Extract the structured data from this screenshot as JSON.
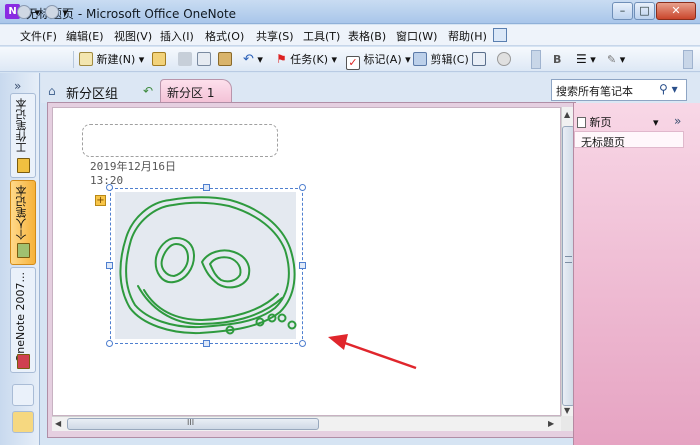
{
  "window": {
    "title": "无标题页 - Microsoft Office OneNote",
    "min": "–",
    "max": "□",
    "close": "✕"
  },
  "menu": [
    "文件(F)",
    "编辑(E)",
    "视图(V)",
    "插入(I)",
    "格式(O)",
    "共享(S)",
    "工具(T)",
    "表格(B)",
    "窗口(W)",
    "帮助(H)"
  ],
  "toolbar": {
    "new_label": "新建(N)",
    "task_label": "任务(K)",
    "tag_label": "标记(A)",
    "clip_label": "剪辑(C)",
    "bold_label": "B"
  },
  "notebooks": [
    {
      "label": "工作笔记本",
      "color": "#f0c040"
    },
    {
      "label": "个人笔记本",
      "color": "#a0c070"
    },
    {
      "label": "OneNote 2007...",
      "color": "#d04050"
    }
  ],
  "nav_expand": "»",
  "section": {
    "group_label": "新分区组",
    "tab_label": "新分区 1"
  },
  "search": {
    "placeholder": "搜索所有笔记本"
  },
  "note": {
    "date": "2019年12月16日",
    "time": "13:20",
    "plus": "+"
  },
  "pages": {
    "new_page_label": "新页",
    "collapse": "»",
    "items": [
      "无标题页"
    ]
  },
  "scroll": {
    "thumb_grip": "III"
  },
  "colors": {
    "ink": "#2e9a3e",
    "arrow": "#e0262c",
    "section_tab": "#f3c1d6"
  }
}
